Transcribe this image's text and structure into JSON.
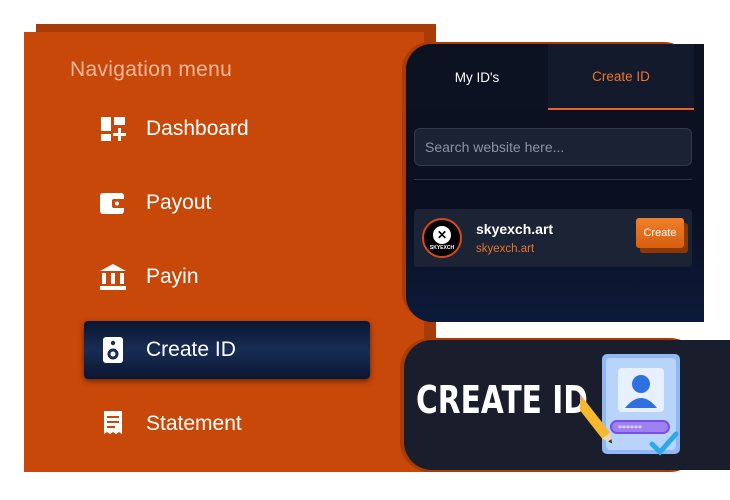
{
  "nav": {
    "title": "Navigation menu",
    "items": [
      {
        "label": "Dashboard",
        "icon": "dashboard-icon"
      },
      {
        "label": "Payout",
        "icon": "wallet-icon"
      },
      {
        "label": "Payin",
        "icon": "bank-icon"
      },
      {
        "label": "Create ID",
        "icon": "speaker-icon",
        "active": true
      },
      {
        "label": "Statement",
        "icon": "receipt-icon"
      }
    ]
  },
  "ids_panel": {
    "tabs": [
      {
        "label": "My ID's"
      },
      {
        "label": "Create ID",
        "active": true
      }
    ],
    "search_placeholder": "Search website here...",
    "site": {
      "logo_text": "SKYEXCH",
      "name": "skyexch.art",
      "url": "skyexch.art",
      "button_label": "Create"
    }
  },
  "banner": {
    "title": "CREATE ID",
    "icon": "id-card-icon"
  },
  "colors": {
    "accent": "#e8622a",
    "panel_orange": "#c8480a",
    "dark_navy": "#0d1222"
  }
}
